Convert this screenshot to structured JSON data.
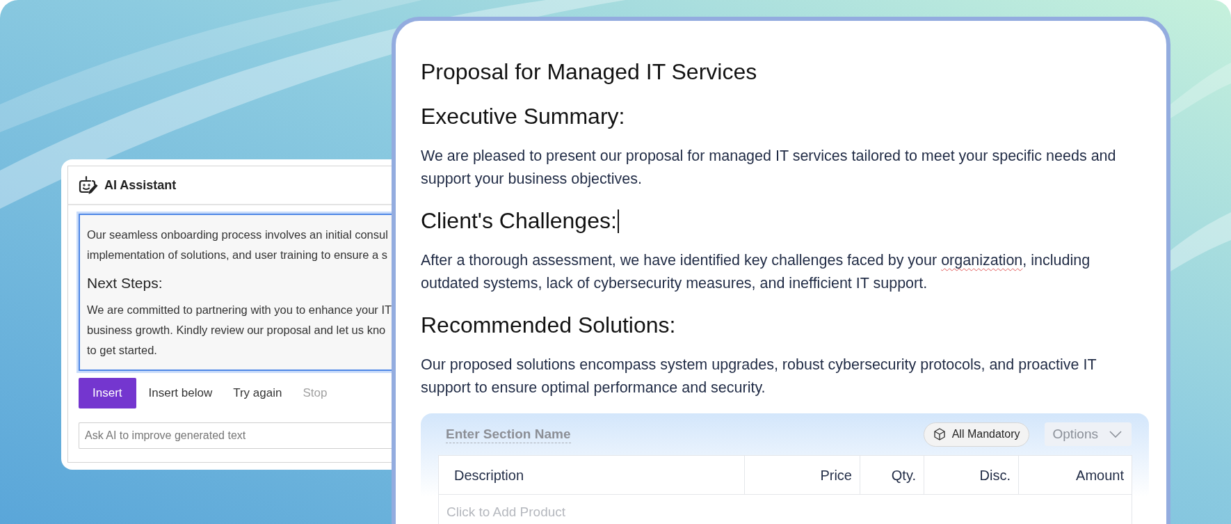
{
  "ai_assistant": {
    "title": "AI Assistant",
    "generated_text": [
      {
        "kind": "paragraph",
        "lines": [
          "Our seamless onboarding process involves an initial consul",
          "implementation of solutions, and user training to ensure a s"
        ]
      },
      {
        "kind": "heading",
        "lines": [
          "Next Steps:"
        ]
      },
      {
        "kind": "paragraph",
        "lines": [
          "We are committed to partnering with you to enhance your IT",
          "business growth. Kindly review our proposal and let us kno",
          "to get started."
        ]
      }
    ],
    "actions": [
      {
        "label": "Insert",
        "kind": "primary",
        "disabled": false
      },
      {
        "label": "Insert below",
        "kind": "link",
        "disabled": false
      },
      {
        "label": "Try again",
        "kind": "link",
        "disabled": false
      },
      {
        "label": "Stop",
        "kind": "link",
        "disabled": true
      }
    ],
    "prompt": {
      "placeholder": "Ask AI to improve generated text"
    }
  },
  "document": {
    "title": "Proposal for Managed IT Services",
    "sections": [
      {
        "heading": "Executive Summary:",
        "cursor": false,
        "lines": [
          [
            {
              "text": "We are pleased to present our proposal for managed IT services tailored to meet your specific needs and",
              "misspelled": false
            }
          ],
          [
            {
              "text": "support your business objectives.",
              "misspelled": false
            }
          ]
        ]
      },
      {
        "heading": "Client's Challenges:",
        "cursor": true,
        "lines": [
          [
            {
              "text": "After a thorough assessment, we have identified key challenges faced by your ",
              "misspelled": false
            },
            {
              "text": "organization",
              "misspelled": true
            },
            {
              "text": ", including",
              "misspelled": false
            }
          ],
          [
            {
              "text": "outdated systems, lack of cybersecurity measures, and inefficient IT support.",
              "misspelled": false
            }
          ]
        ]
      },
      {
        "heading": "Recommended Solutions:",
        "cursor": false,
        "lines": [
          [
            {
              "text": "Our proposed solutions encompass system upgrades, robust cybersecurity protocols, and proactive IT",
              "misspelled": false
            }
          ],
          [
            {
              "text": "support to ensure optimal performance and security.",
              "misspelled": false
            }
          ]
        ]
      }
    ],
    "pricing_section": {
      "name_placeholder": "Enter Section Name",
      "mandatory_label": "All Mandatory",
      "options_label": "Options",
      "columns": [
        "Description",
        "Price",
        "Qty.",
        "Disc.",
        "Amount"
      ],
      "empty_row_prompt": "Click to Add Product"
    }
  }
}
